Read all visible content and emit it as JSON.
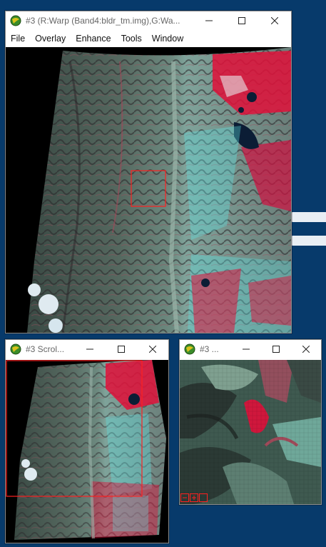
{
  "main_window": {
    "title": "#3 (R:Warp (Band4:bldr_tm.img),G:Wa...",
    "menus": [
      "File",
      "Overlay",
      "Enhance",
      "Tools",
      "Window"
    ]
  },
  "scroll_window": {
    "title": "#3 Scrol..."
  },
  "zoom_window": {
    "title": "#3 ..."
  },
  "colors": {
    "desktop": "#073a6b",
    "selection_box": "#ff2020",
    "vegetation_red": "#e0103a",
    "water_cyan": "#5ee6e6"
  },
  "icons": {
    "app": "envi-globe-icon",
    "minimize": "minimize-icon",
    "maximize": "maximize-icon",
    "close": "close-icon",
    "zoom_controls": [
      "zoom-out-icon",
      "zoom-in-icon",
      "zoom-reset-icon"
    ]
  }
}
